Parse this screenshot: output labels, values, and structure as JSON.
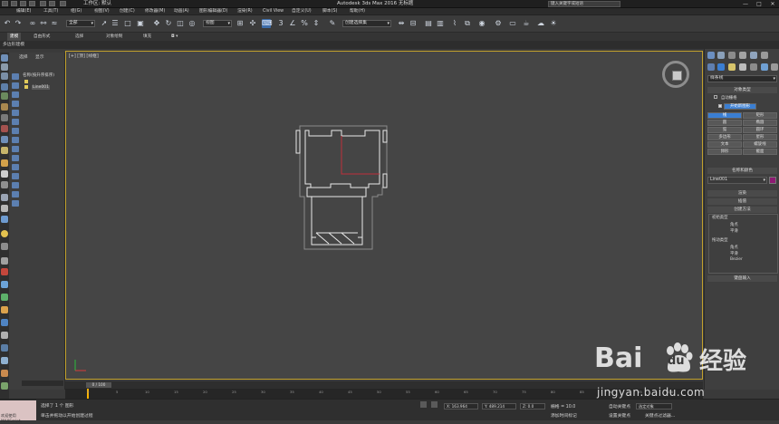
{
  "title_bar": {
    "workspace_label": "工作区: 默认",
    "window_title": "Autodesk 3ds Max 2016   无标题",
    "search_placeholder": "键入关键字或短语",
    "minimize": "—",
    "maximize": "□",
    "close": "✕"
  },
  "menu": {
    "items": [
      "编辑(E)",
      "工具(T)",
      "组(G)",
      "视图(V)",
      "创建(C)",
      "修改器(M)",
      "动画(A)",
      "图形编辑器(D)",
      "渲染(R)",
      "Civil View",
      "自定义(U)",
      "脚本(S)",
      "帮助(H)"
    ]
  },
  "toolbar": {
    "selection_filter": "全部",
    "reference_coord": "视图",
    "named_selection": "创建选择集"
  },
  "ribbon": {
    "tabs": [
      "建模",
      "自由形式",
      "选择",
      "对象绘制",
      "填充"
    ],
    "active_tab": "建模",
    "sub_label": "多边形建模"
  },
  "explorer": {
    "tabs": [
      "选择",
      "显示"
    ],
    "tree": [
      "名称(按升序排序)",
      "Line001"
    ]
  },
  "viewport": {
    "label": "[+] [顶] [线框]"
  },
  "command_panel": {
    "dropdown": "样条线",
    "object_type_header": "对象类型",
    "auto_grid": "自动栅格",
    "start_new_shape": "开始新图形",
    "buttons": [
      "线",
      "矩形",
      "圆",
      "椭圆",
      "弧",
      "圆环",
      "多边形",
      "星形",
      "文本",
      "螺旋线",
      "卵形",
      "截面"
    ],
    "name_color_header": "名称和颜色",
    "name_value": "Line001",
    "rollouts": [
      "渲染",
      "插值",
      "创建方法"
    ],
    "initial_type_label": "初始类型",
    "initial_types": [
      "角点",
      "平滑"
    ],
    "drag_type_label": "拖动类型",
    "drag_types": [
      "角点",
      "平滑",
      "Bezier"
    ],
    "keyboard_entry": "键盘输入"
  },
  "timeline": {
    "thumb": "0 / 100",
    "ticks": [
      "0",
      "5",
      "10",
      "15",
      "20",
      "25",
      "30",
      "35",
      "40",
      "45",
      "50",
      "55",
      "60",
      "65",
      "70",
      "75",
      "80",
      "85",
      "90",
      "95",
      "100"
    ]
  },
  "status": {
    "maxscript": "欢迎使用 MAXScript。",
    "selection": "选择了 1 个 图形",
    "prompt": "单击并拖动以开始创建过程",
    "x_value": "X: 163.964",
    "y_value": "Y: 489.214",
    "z_value": "Z: 0.0",
    "grid": "栅格 = 10.0",
    "auto_key": "自动关键点",
    "set_key": "设置关键点",
    "key_filter": "选定对象",
    "key_filters_btn": "关键点过滤器...",
    "add_time_tag": "添加时间标记"
  },
  "watermark": {
    "brand_left": "Bai",
    "brand_du": "du",
    "brand_right": "经验",
    "url": "jingyan.baidu.com"
  },
  "colors": {
    "viewport_border": "#c2a12c",
    "selected_button": "#3a7ed2",
    "shape_lines": "#e9e9e9",
    "selected_segment": "#c0303a"
  }
}
